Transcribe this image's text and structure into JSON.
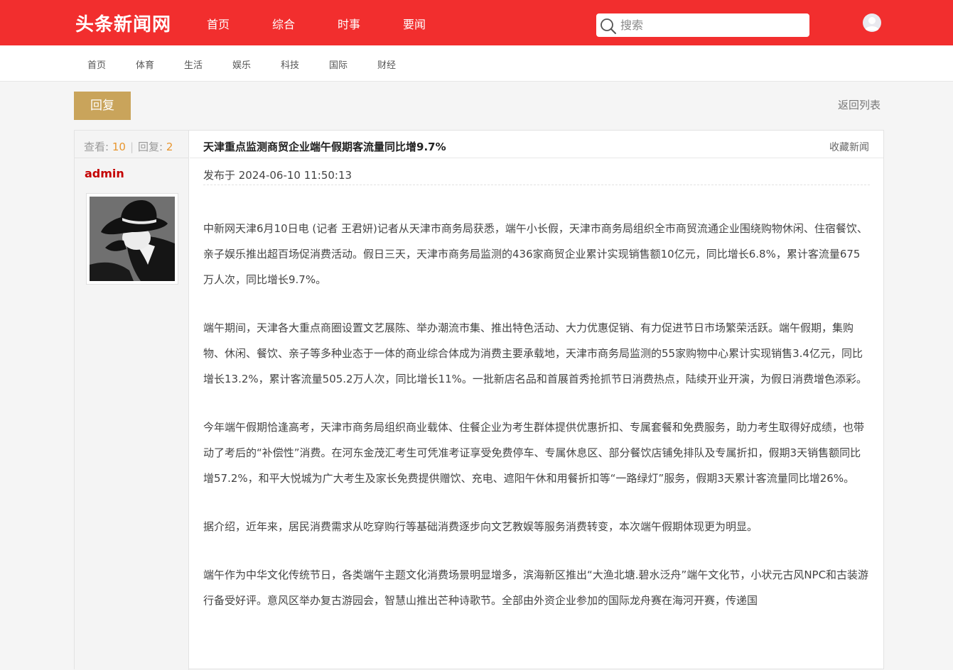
{
  "header": {
    "logo": "头条新闻网",
    "nav": [
      "首页",
      "综合",
      "时事",
      "要闻"
    ],
    "search_placeholder": "搜索"
  },
  "subnav": [
    "首页",
    "体育",
    "生活",
    "娱乐",
    "科技",
    "国际",
    "财经"
  ],
  "actions": {
    "reply_label": "回复",
    "back_label": "返回列表"
  },
  "post": {
    "views_label": "查看:",
    "views": "10",
    "replies_label": "回复:",
    "replies": "2",
    "author": "admin",
    "title": "天津重点监测商贸企业端午假期客流量同比增9.7%",
    "favorite_label": "收藏新闻",
    "published": "发布于 2024-06-10 11:50:13",
    "paragraphs": [
      "中新网天津6月10日电 (记者 王君妍)记者从天津市商务局获悉，端午小长假，天津市商务局组织全市商贸流通企业围绕购物休闲、住宿餐饮、亲子娱乐推出超百场促消费活动。假日三天，天津市商务局监测的436家商贸企业累计实现销售额10亿元，同比增长6.8%，累计客流量675万人次，同比增长9.7%。",
      "端午期间，天津各大重点商圈设置文艺展陈、举办潮流市集、推出特色活动、大力优惠促销、有力促进节日市场繁荣活跃。端午假期，集购物、休闲、餐饮、亲子等多种业态于一体的商业综合体成为消费主要承载地，天津市商务局监测的55家购物中心累计实现销售3.4亿元，同比增长13.2%，累计客流量505.2万人次，同比增长11%。一批新店名品和首展首秀抢抓节日消费热点，陆续开业开演，为假日消费增色添彩。",
      "今年端午假期恰逢高考，天津市商务局组织商业载体、住餐企业为考生群体提供优惠折扣、专属套餐和免费服务，助力考生取得好成绩，也带动了考后的“补偿性”消费。在河东金茂汇考生可凭准考证享受免费停车、专属休息区、部分餐饮店铺免排队及专属折扣，假期3天销售额同比增57.2%，和平大悦城为广大考生及家长免费提供赠饮、充电、遮阳午休和用餐折扣等“一路绿灯”服务，假期3天累计客流量同比增26%。",
      "据介绍，近年来，居民消费需求从吃穿购行等基础消费逐步向文艺教娱等服务消费转变，本次端午假期体现更为明显。",
      "端午作为中华文化传统节日，各类端午主题文化消费场景明显增多，滨海新区推出“大渔北塘.碧水泛舟”端午文化节，小状元古风NPC和古装游行备受好评。意风区举办复古游园会，智慧山推出芒种诗歌节。全部由外资企业参加的国际龙舟赛在海河开赛，传递国"
    ]
  },
  "colors": {
    "header_bg": "#f22e2e",
    "reply_button": "#c9a45b",
    "author": "#c40000",
    "stat_number": "#e8962f"
  }
}
